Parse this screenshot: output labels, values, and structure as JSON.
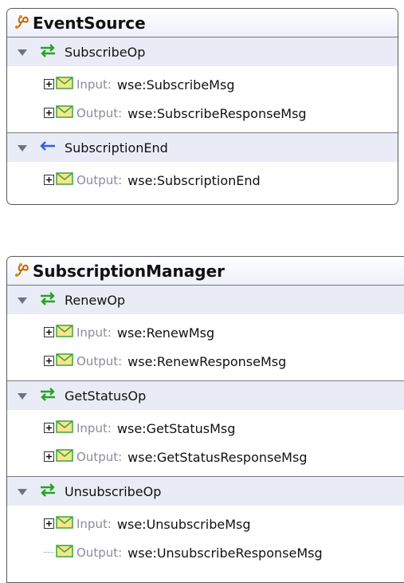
{
  "port_types": [
    {
      "name": "EventSource",
      "operations": [
        {
          "name": "SubscribeOp",
          "direction": "request-response",
          "messages": [
            {
              "label": "Input:",
              "type": "wse:SubscribeMsg",
              "expandable": true
            },
            {
              "label": "Output:",
              "type": "wse:SubscribeResponseMsg",
              "expandable": true
            }
          ]
        },
        {
          "name": "SubscriptionEnd",
          "direction": "notification",
          "messages": [
            {
              "label": "Output:",
              "type": "wse:SubscriptionEnd",
              "expandable": true
            }
          ]
        }
      ]
    },
    {
      "name": "SubscriptionManager",
      "operations": [
        {
          "name": "RenewOp",
          "direction": "request-response",
          "messages": [
            {
              "label": "Input:",
              "type": "wse:RenewMsg",
              "expandable": true
            },
            {
              "label": "Output:",
              "type": "wse:RenewResponseMsg",
              "expandable": true
            }
          ]
        },
        {
          "name": "GetStatusOp",
          "direction": "request-response",
          "messages": [
            {
              "label": "Input:",
              "type": "wse:GetStatusMsg",
              "expandable": true
            },
            {
              "label": "Output:",
              "type": "wse:GetStatusResponseMsg",
              "expandable": true
            }
          ]
        },
        {
          "name": "UnsubscribeOp",
          "direction": "request-response",
          "messages": [
            {
              "label": "Input:",
              "type": "wse:UnsubscribeMsg",
              "expandable": true
            },
            {
              "label": "Output:",
              "type": "wse:UnsubscribeResponseMsg",
              "expandable": false
            }
          ]
        }
      ]
    }
  ],
  "icons": {
    "port_type": "porttype-icon",
    "collapse": "triangle-down-icon",
    "request_response": "two-way-arrows-icon",
    "notification": "left-arrow-icon",
    "expand": "plus-box-icon",
    "message": "envelope-icon"
  },
  "colors": {
    "frame_border": "#5a5a5a",
    "header_fill": "#eef0fb",
    "operation_band": "#e9ebf7",
    "arrow_green": "#22a51e",
    "arrow_blue": "#2c5ee8",
    "envelope_fill": "#f7e58c",
    "envelope_stroke": "#3fa33f",
    "label_gray": "#8b8b9c"
  }
}
